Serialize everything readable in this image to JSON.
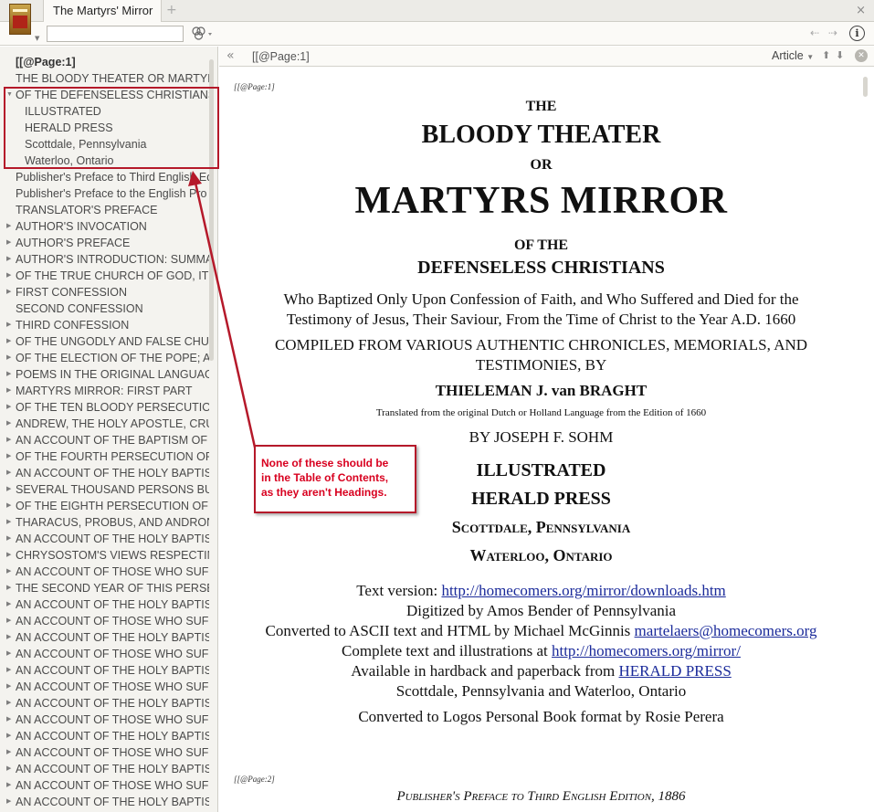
{
  "tab": {
    "title": "The Martyrs' Mirror",
    "add": "+",
    "close": "×"
  },
  "toolbar": {
    "search_value": "",
    "back": "⇠",
    "forward": "⇢",
    "info": "i"
  },
  "sidebar": {
    "items": [
      {
        "label": "[[@Page:1]",
        "level": 0,
        "expander": "",
        "bold": true
      },
      {
        "label": "THE BLOODY THEATER OR MARTYRS MIRROR",
        "level": 0,
        "expander": ""
      },
      {
        "label": "OF THE DEFENSELESS CHRISTIANS",
        "level": 0,
        "expander": "▼"
      },
      {
        "label": "ILLUSTRATED",
        "level": 1,
        "expander": ""
      },
      {
        "label": "HERALD PRESS",
        "level": 1,
        "expander": ""
      },
      {
        "label": "Scottdale, Pennsylvania",
        "level": 1,
        "expander": ""
      },
      {
        "label": "Waterloo, Ontario",
        "level": 1,
        "expander": ""
      },
      {
        "label": "Publisher's Preface to Third English Edition",
        "level": 0,
        "expander": ""
      },
      {
        "label": "Publisher's Preface to the English Pro",
        "level": 0,
        "expander": ""
      },
      {
        "label": "TRANSLATOR'S PREFACE",
        "level": 0,
        "expander": ""
      },
      {
        "label": "AUTHOR'S INVOCATION",
        "level": 0,
        "expander": "▶"
      },
      {
        "label": "AUTHOR'S PREFACE",
        "level": 0,
        "expander": "▶"
      },
      {
        "label": "AUTHOR'S INTRODUCTION: SUMMARY",
        "level": 0,
        "expander": "▶"
      },
      {
        "label": "OF THE TRUE CHURCH OF GOD, ITS ORIGIN",
        "level": 0,
        "expander": "▶"
      },
      {
        "label": "FIRST CONFESSION",
        "level": 0,
        "expander": "▶"
      },
      {
        "label": "SECOND CONFESSION",
        "level": 0,
        "expander": ""
      },
      {
        "label": "THIRD CONFESSION",
        "level": 0,
        "expander": "▶"
      },
      {
        "label": "OF THE UNGODLY AND FALSE CHURCH",
        "level": 0,
        "expander": "▶"
      },
      {
        "label": "OF THE ELECTION OF THE POPE; AND",
        "level": 0,
        "expander": "▶"
      },
      {
        "label": "POEMS IN THE ORIGINAL LANGUAGE",
        "level": 0,
        "expander": "▶"
      },
      {
        "label": "MARTYRS MIRROR: FIRST PART",
        "level": 0,
        "expander": "▶"
      },
      {
        "label": "OF THE TEN BLOODY PERSECUTIONS",
        "level": 0,
        "expander": "▶"
      },
      {
        "label": "ANDREW, THE HOLY APOSTLE, CRUCIFIED",
        "level": 0,
        "expander": "▶"
      },
      {
        "label": "AN ACCOUNT OF THE BAPTISM OF THE",
        "level": 0,
        "expander": "▶"
      },
      {
        "label": "OF THE FOURTH PERSECUTION OF THE",
        "level": 0,
        "expander": "▶"
      },
      {
        "label": "AN ACCOUNT OF THE HOLY BAPTISM",
        "level": 0,
        "expander": "▶"
      },
      {
        "label": "SEVERAL THOUSAND PERSONS BURNED",
        "level": 0,
        "expander": "▶"
      },
      {
        "label": "OF THE EIGHTH PERSECUTION OF THE",
        "level": 0,
        "expander": "▶"
      },
      {
        "label": "THARACUS, PROBUS, AND ANDRONICUS",
        "level": 0,
        "expander": "▶"
      },
      {
        "label": "AN ACCOUNT OF THE HOLY BAPTISM",
        "level": 0,
        "expander": "▶"
      },
      {
        "label": "CHRYSOSTOM'S VIEWS RESPECTING",
        "level": 0,
        "expander": "▶"
      },
      {
        "label": "AN ACCOUNT OF THOSE WHO SUFFERED",
        "level": 0,
        "expander": "▶"
      },
      {
        "label": "THE SECOND YEAR OF THIS PERSECUTION",
        "level": 0,
        "expander": "▶"
      },
      {
        "label": "AN ACCOUNT OF THE HOLY BAPTISM",
        "level": 0,
        "expander": "▶"
      },
      {
        "label": "AN ACCOUNT OF THOSE WHO SUFFERED",
        "level": 0,
        "expander": "▶"
      },
      {
        "label": "AN ACCOUNT OF THE HOLY BAPTISM",
        "level": 0,
        "expander": "▶"
      },
      {
        "label": "AN ACCOUNT OF THOSE WHO SUFFERED",
        "level": 0,
        "expander": "▶"
      },
      {
        "label": "AN ACCOUNT OF THE HOLY BAPTISM",
        "level": 0,
        "expander": "▶"
      },
      {
        "label": "AN ACCOUNT OF THOSE WHO SUFFERED",
        "level": 0,
        "expander": "▶"
      },
      {
        "label": "AN ACCOUNT OF THE HOLY BAPTISM",
        "level": 0,
        "expander": "▶"
      },
      {
        "label": "AN ACCOUNT OF THOSE WHO SUFFERED",
        "level": 0,
        "expander": "▶"
      },
      {
        "label": "AN ACCOUNT OF THE HOLY BAPTISM",
        "level": 0,
        "expander": "▶"
      },
      {
        "label": "AN ACCOUNT OF THOSE WHO SUFFERED",
        "level": 0,
        "expander": "▶"
      },
      {
        "label": "AN ACCOUNT OF THE HOLY BAPTISM",
        "level": 0,
        "expander": "▶"
      },
      {
        "label": "AN ACCOUNT OF THOSE WHO SUFFERED",
        "level": 0,
        "expander": "▶"
      },
      {
        "label": "AN ACCOUNT OF THE HOLY BAPTISM",
        "level": 0,
        "expander": "▶"
      }
    ]
  },
  "callout": {
    "line1": "None of these should be",
    "line2": "in the Table of Contents,",
    "line3": "as they aren't Headings."
  },
  "content_header": {
    "collapse": "«",
    "reference": "[[@Page:1]",
    "view": "Article",
    "view_caret": "▼",
    "up": "⬆",
    "down": "⬇",
    "close": "✕"
  },
  "article": {
    "page_ref_1": "[[@Page:1]",
    "the": "THE",
    "bloody_theater": "BLOODY THEATER",
    "or": "OR",
    "martyrs_mirror": "MARTYRS MIRROR",
    "of_the": "OF THE",
    "defenseless": "DEFENSELESS CHRISTIANS",
    "who_line1": "Who Baptized Only Upon Confession of Faith, and Who Suffered and Died for the",
    "who_line2": "Testimony of Jesus, Their Saviour, From the Time of Christ to the Year A.D. 1660",
    "compiled_line1": "COMPILED FROM VARIOUS AUTHENTIC CHRONICLES, MEMORIALS, AND",
    "compiled_line2": "TESTIMONIES, BY",
    "author": "THIELEMAN J. van BRAGHT",
    "translated": "Translated from the original Dutch or Holland Language from the Edition of 1660",
    "by_sohm": "BY JOSEPH F. SOHM",
    "illustrated": "ILLUSTRATED",
    "herald_press": "HERALD PRESS",
    "scottdale": "Scottdale, Pennsylvania",
    "waterloo": "Waterloo, Ontario",
    "text_version_label": "Text version: ",
    "text_version_link": "http://homecomers.org/mirror/downloads.htm",
    "digitized": "Digitized by Amos Bender of Pennsylvania",
    "converted_label": "Converted to ASCII text and HTML by Michael McGinnis ",
    "converted_email": "martelaers@homecomers.org",
    "complete_label": "Complete text and illustrations at ",
    "complete_link": "http://homecomers.org/mirror/",
    "available_label": "Available in hardback and paperback from ",
    "available_link": "HERALD PRESS",
    "scottdale_waterloo": "Scottdale, Pennsylvania and Waterloo, Ontario",
    "converted_logos": "Converted to Logos Personal Book format by Rosie Perera",
    "page_ref_2": "[[@Page:2]",
    "publisher_preface": "Publisher's Preface to Third English Edition, 1886"
  }
}
